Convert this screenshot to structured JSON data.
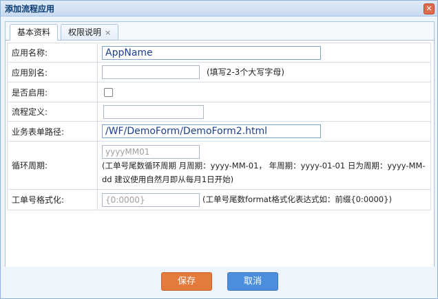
{
  "dialog": {
    "title": "添加流程应用",
    "close_glyph": "✕"
  },
  "tabs": [
    {
      "label": "基本资料"
    },
    {
      "label": "权限说明",
      "close": "×"
    }
  ],
  "form": {
    "app_name": {
      "label": "应用名称:",
      "value": "AppName"
    },
    "app_alias": {
      "label": "应用别名:",
      "value": "",
      "hint": "(填写2-3个大写字母)"
    },
    "enabled": {
      "label": "是否启用:",
      "checked": false
    },
    "flow_def": {
      "label": "流程定义:",
      "value": ""
    },
    "form_path": {
      "label": "业务表单路径:",
      "value": "/WF/DemoForm/DemoForm2.html"
    },
    "cycle": {
      "label": "循环周期:",
      "placeholder": "yyyyMM01",
      "hint": "(工单号尾数循环周期 月周期：yyyy-MM-01， 年周期：yyyy-01-01 日为周期：yyyy-MM-dd 建议使用自然月即从每月1日开始)"
    },
    "order_format": {
      "label": "工单号格式化:",
      "placeholder": "{0:0000}",
      "hint": "(工单号尾数format格式化表达式如：前缀{0:0000})"
    }
  },
  "buttons": {
    "save": "保存",
    "cancel": "取消"
  },
  "colors": {
    "save": "#e57a3d",
    "cancel": "#4b8fdc",
    "title_text": "#0b3a6e"
  }
}
